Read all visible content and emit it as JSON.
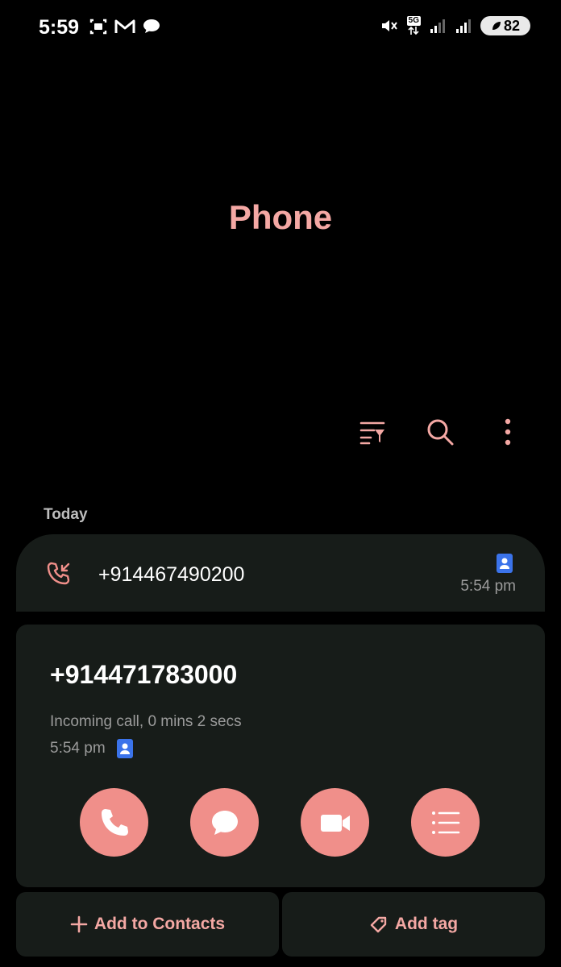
{
  "status_bar": {
    "time": "5:59",
    "network": "5G",
    "battery": "82",
    "icons": [
      "screenshot-icon",
      "gmail-icon",
      "chat-icon",
      "mute-icon",
      "signal-icon",
      "signal-icon",
      "battery-saver-icon"
    ]
  },
  "header": {
    "title": "Phone"
  },
  "toolbar": {
    "icons": [
      "filter-icon",
      "search-icon",
      "more-options-icon"
    ]
  },
  "section": {
    "label": "Today"
  },
  "call_log": [
    {
      "number": "+914467490200",
      "time": "5:54 pm",
      "type": "incoming"
    }
  ],
  "details": {
    "number": "+914471783000",
    "description": "Incoming call, 0 mins 2 secs",
    "time": "5:54 pm",
    "actions": [
      "call-icon",
      "message-icon",
      "video-call-icon",
      "details-icon"
    ]
  },
  "buttons": {
    "add_to_contacts": "Add to Contacts",
    "add_tag": "Add tag"
  },
  "colors": {
    "accent": "#f4a8a4",
    "action_bg": "#f08f8a",
    "card_bg": "#171c19",
    "contact_badge": "#3b73ea"
  }
}
